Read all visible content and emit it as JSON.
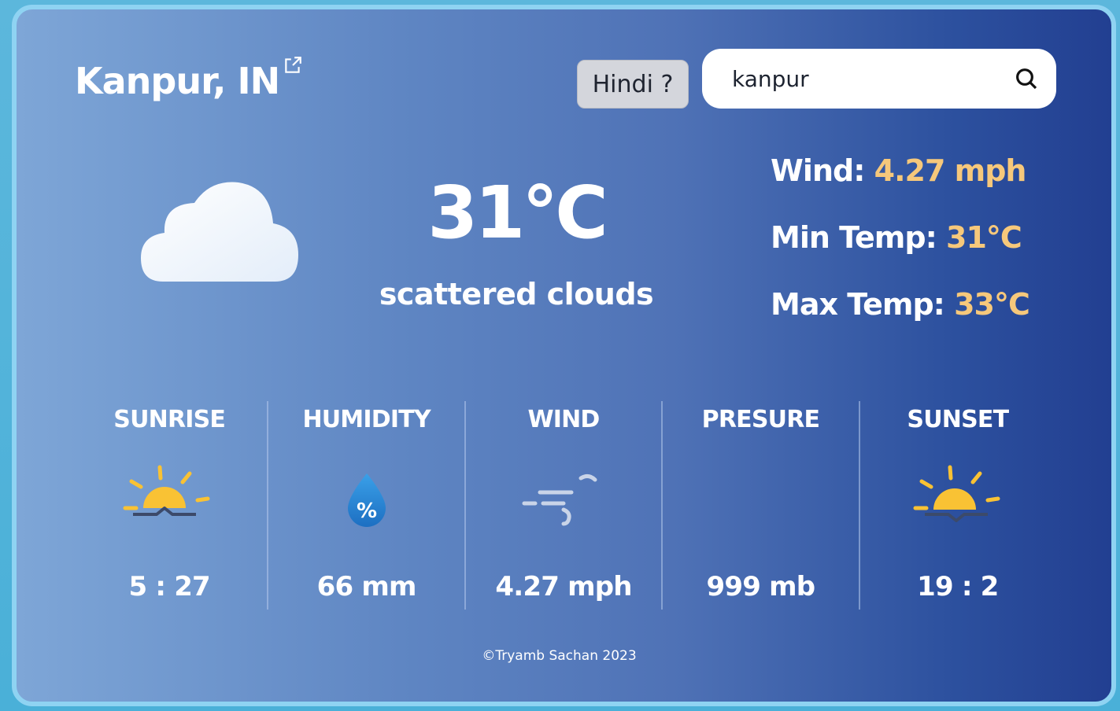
{
  "header": {
    "city": "Kanpur, IN",
    "language_button": "Hindi ?",
    "search_value": "kanpur"
  },
  "current": {
    "temperature": "31°C",
    "description": "scattered clouds",
    "icon": "cloud-icon"
  },
  "stats": {
    "wind_label": "Wind: ",
    "wind_value": "4.27 mph",
    "min_label": "Min Temp: ",
    "min_value": "31°C",
    "max_label": "Max Temp: ",
    "max_value": "33°C"
  },
  "metrics": [
    {
      "title": "SUNRISE",
      "value": "5 : 27",
      "icon": "sunrise-icon"
    },
    {
      "title": "HUMIDITY",
      "value": "66 mm",
      "icon": "humidity-drop-icon"
    },
    {
      "title": "WIND",
      "value": "4.27 mph",
      "icon": "wind-icon"
    },
    {
      "title": "PRESURE",
      "value": "999 mb",
      "icon": ""
    },
    {
      "title": "SUNSET",
      "value": "19 : 2",
      "icon": "sunset-icon"
    }
  ],
  "footer": "©Tryamb Sachan 2023",
  "colors": {
    "accent": "#f6c87b",
    "sun": "#f9c234",
    "bg_left": "#7ea6d7",
    "bg_right": "#223f91"
  }
}
